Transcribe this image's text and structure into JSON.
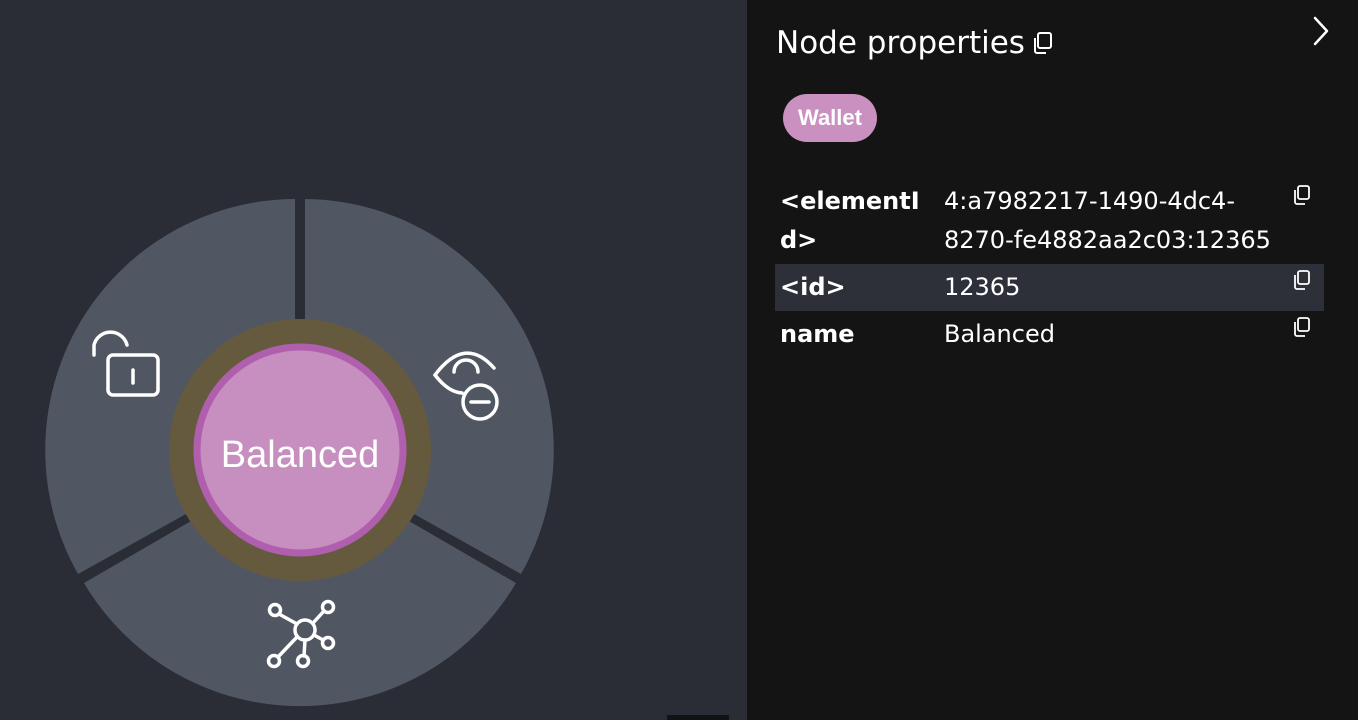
{
  "graph": {
    "node_label": "Balanced",
    "node_fill": "#c78fbf",
    "node_border": "#b05fae",
    "halo": "#655a3e",
    "menu_segment": "#515663",
    "menu_icons": [
      "lock-open-icon",
      "eye-off-icon",
      "graph-expand-icon"
    ]
  },
  "panel": {
    "title": "Node properties",
    "badge": "Wallet",
    "badge_color": "#c990c0",
    "properties": [
      {
        "key": "<elementId>",
        "value": "4:a7982217-1490-4dc4-8270-fe4882aa2c03:12365"
      },
      {
        "key": "<id>",
        "value": "12365"
      },
      {
        "key": "name",
        "value": "Balanced"
      }
    ]
  }
}
